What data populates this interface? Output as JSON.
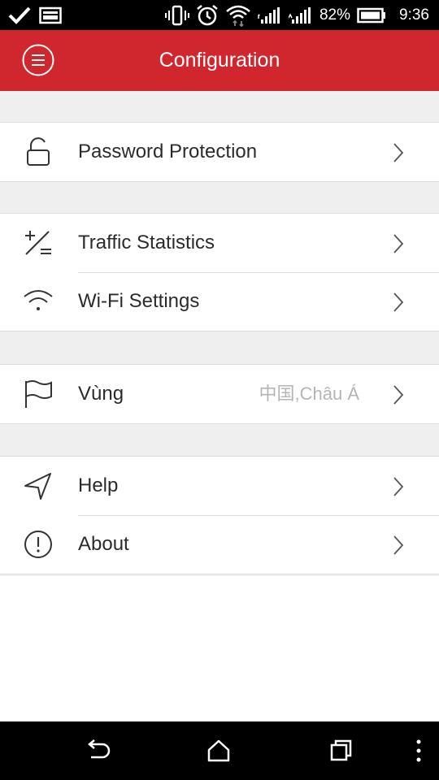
{
  "status_bar": {
    "battery": "82%",
    "time": "9:36",
    "icons": [
      "check-icon",
      "image-icon",
      "vibrate-icon",
      "alarm-icon",
      "wifi-icon",
      "signal-icon",
      "signal-icon",
      "battery-icon"
    ]
  },
  "header": {
    "title": "Configuration",
    "menu_icon": "menu-icon",
    "color": "#d0262e"
  },
  "settings": {
    "groups": [
      {
        "items": [
          {
            "label": "Password Protection",
            "icon": "unlock-icon"
          }
        ]
      },
      {
        "items": [
          {
            "label": "Traffic Statistics",
            "icon": "plus-minus-icon"
          },
          {
            "label": "Wi-Fi Settings",
            "icon": "wifi-icon"
          }
        ]
      },
      {
        "items": [
          {
            "label": "Vùng",
            "value": "中国,Châu Á",
            "icon": "flag-icon"
          }
        ]
      },
      {
        "items": [
          {
            "label": "Help",
            "icon": "navigation-icon"
          },
          {
            "label": "About",
            "icon": "info-icon"
          }
        ]
      }
    ]
  },
  "nav_bar": {
    "icons": [
      "back-icon",
      "home-icon",
      "recents-icon",
      "more-icon"
    ]
  }
}
